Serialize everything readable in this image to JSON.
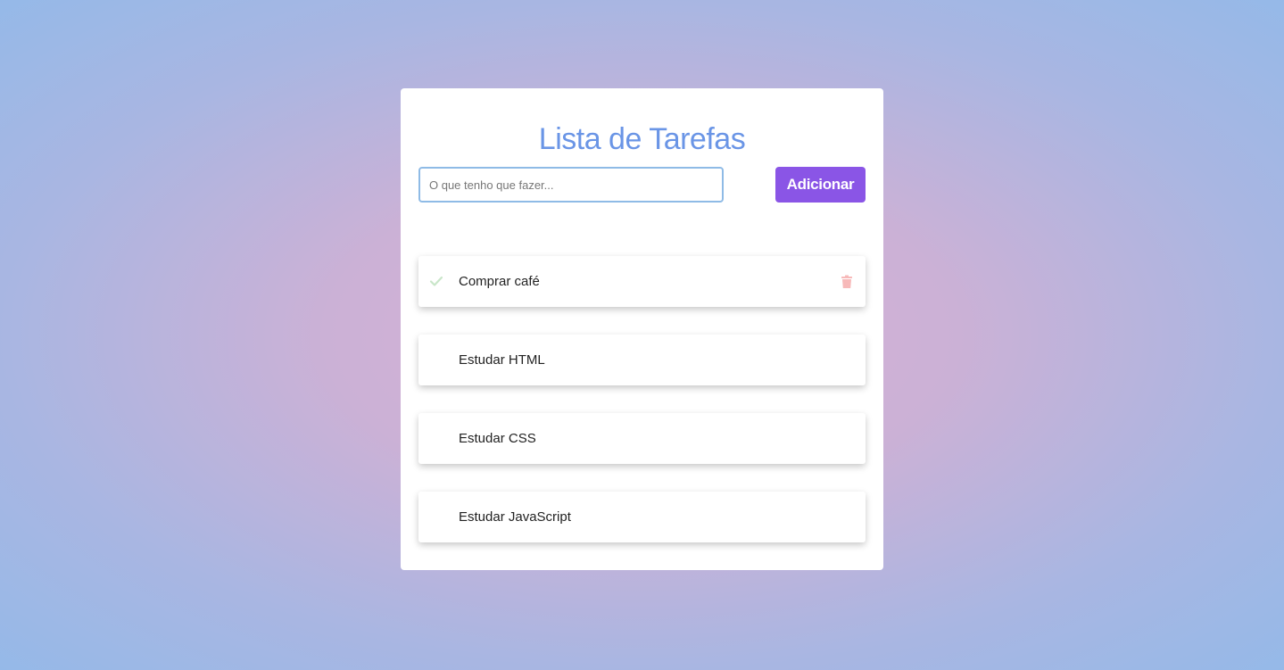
{
  "title": "Lista de Tarefas",
  "input": {
    "value": "",
    "placeholder": "O que tenho que fazer..."
  },
  "add_button": {
    "label": "Adicionar"
  },
  "tasks": [
    {
      "label": "Comprar café",
      "check_icon": "check-icon",
      "delete_icon": "trash-icon",
      "hovered": true
    },
    {
      "label": "Estudar HTML",
      "hovered": false
    },
    {
      "label": "Estudar CSS",
      "hovered": false
    },
    {
      "label": "Estudar JavaScript",
      "hovered": false
    }
  ],
  "colors": {
    "title": "#6a95e6",
    "button": "#8a55e6",
    "input_border": "#8fbbe6",
    "check": "#c9e6c9",
    "delete": "#f7b9b9"
  }
}
